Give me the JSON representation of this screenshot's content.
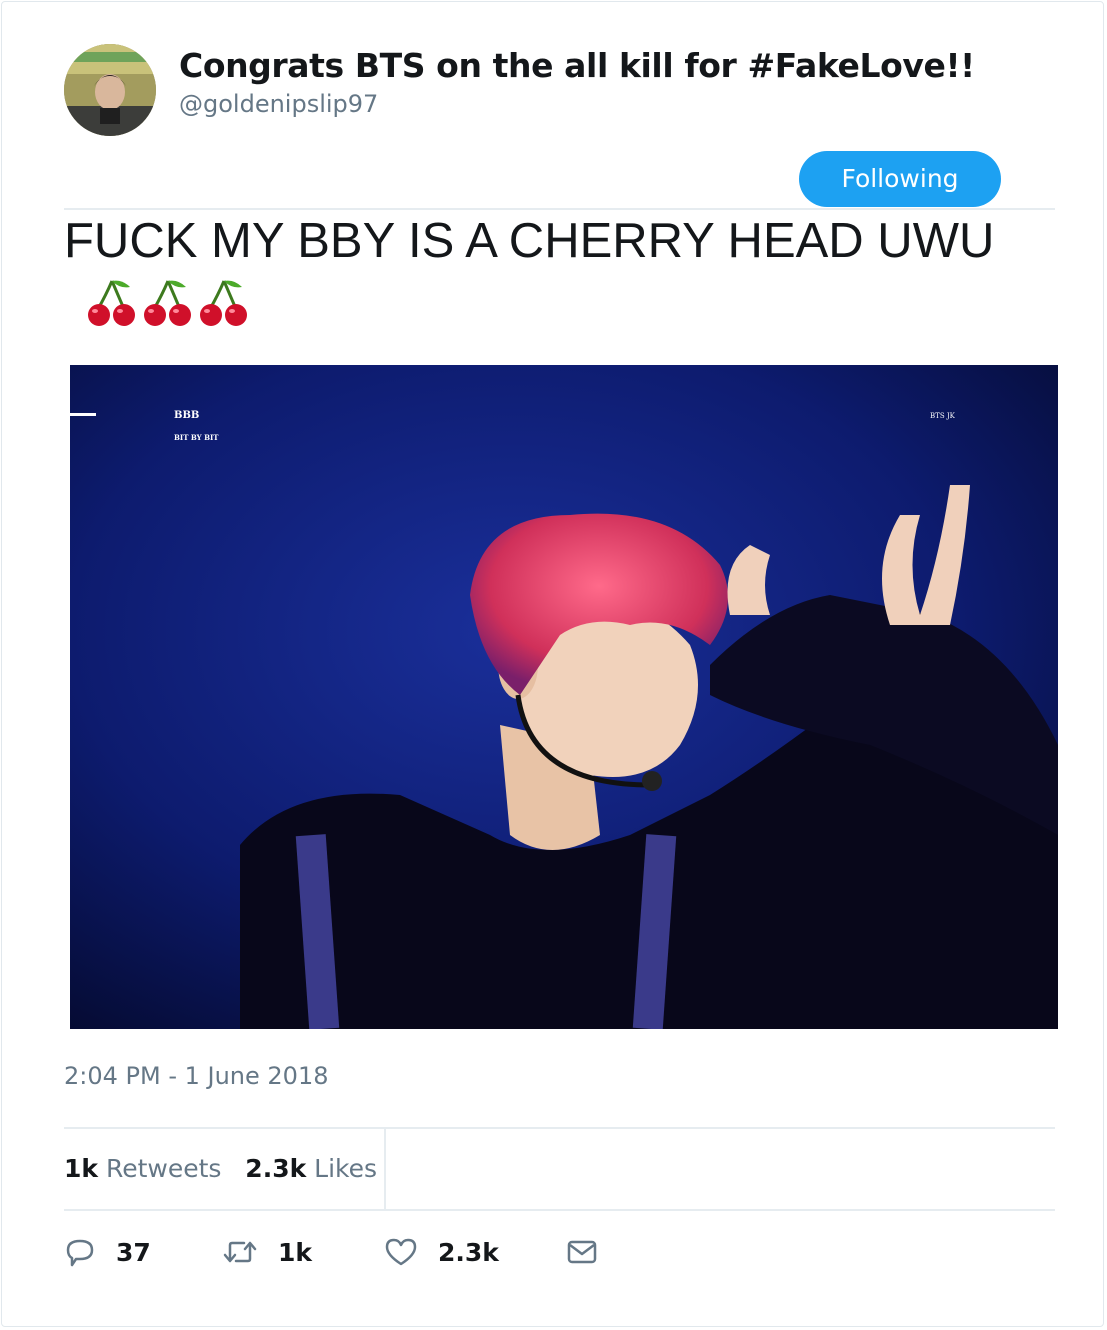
{
  "tweet": {
    "display_name": "Congrats BTS on the all kill for #FakeLove!!",
    "handle": "@goldenipslip97",
    "follow_label": "Following",
    "text": "FUCK MY BBY IS A CHERRY HEAD UWU",
    "emojis": [
      "cherries-emoji",
      "cherries-emoji",
      "cherries-emoji"
    ],
    "media": {
      "watermark_top": "BBB",
      "watermark_sub": "BIT BY BIT",
      "watermark_right": "BTS JK"
    },
    "timestamp": "2:04 PM - 1 June 2018",
    "stats": {
      "retweets_count": "1k",
      "retweets_label": "Retweets",
      "likes_count": "2.3k",
      "likes_label": "Likes"
    },
    "actions": {
      "reply_count": "37",
      "retweet_count": "1k",
      "like_count": "2.3k"
    }
  },
  "colors": {
    "accent": "#1da1f2",
    "text": "#14171a",
    "secondary_text": "#657786",
    "divider": "#e6ecf0"
  }
}
